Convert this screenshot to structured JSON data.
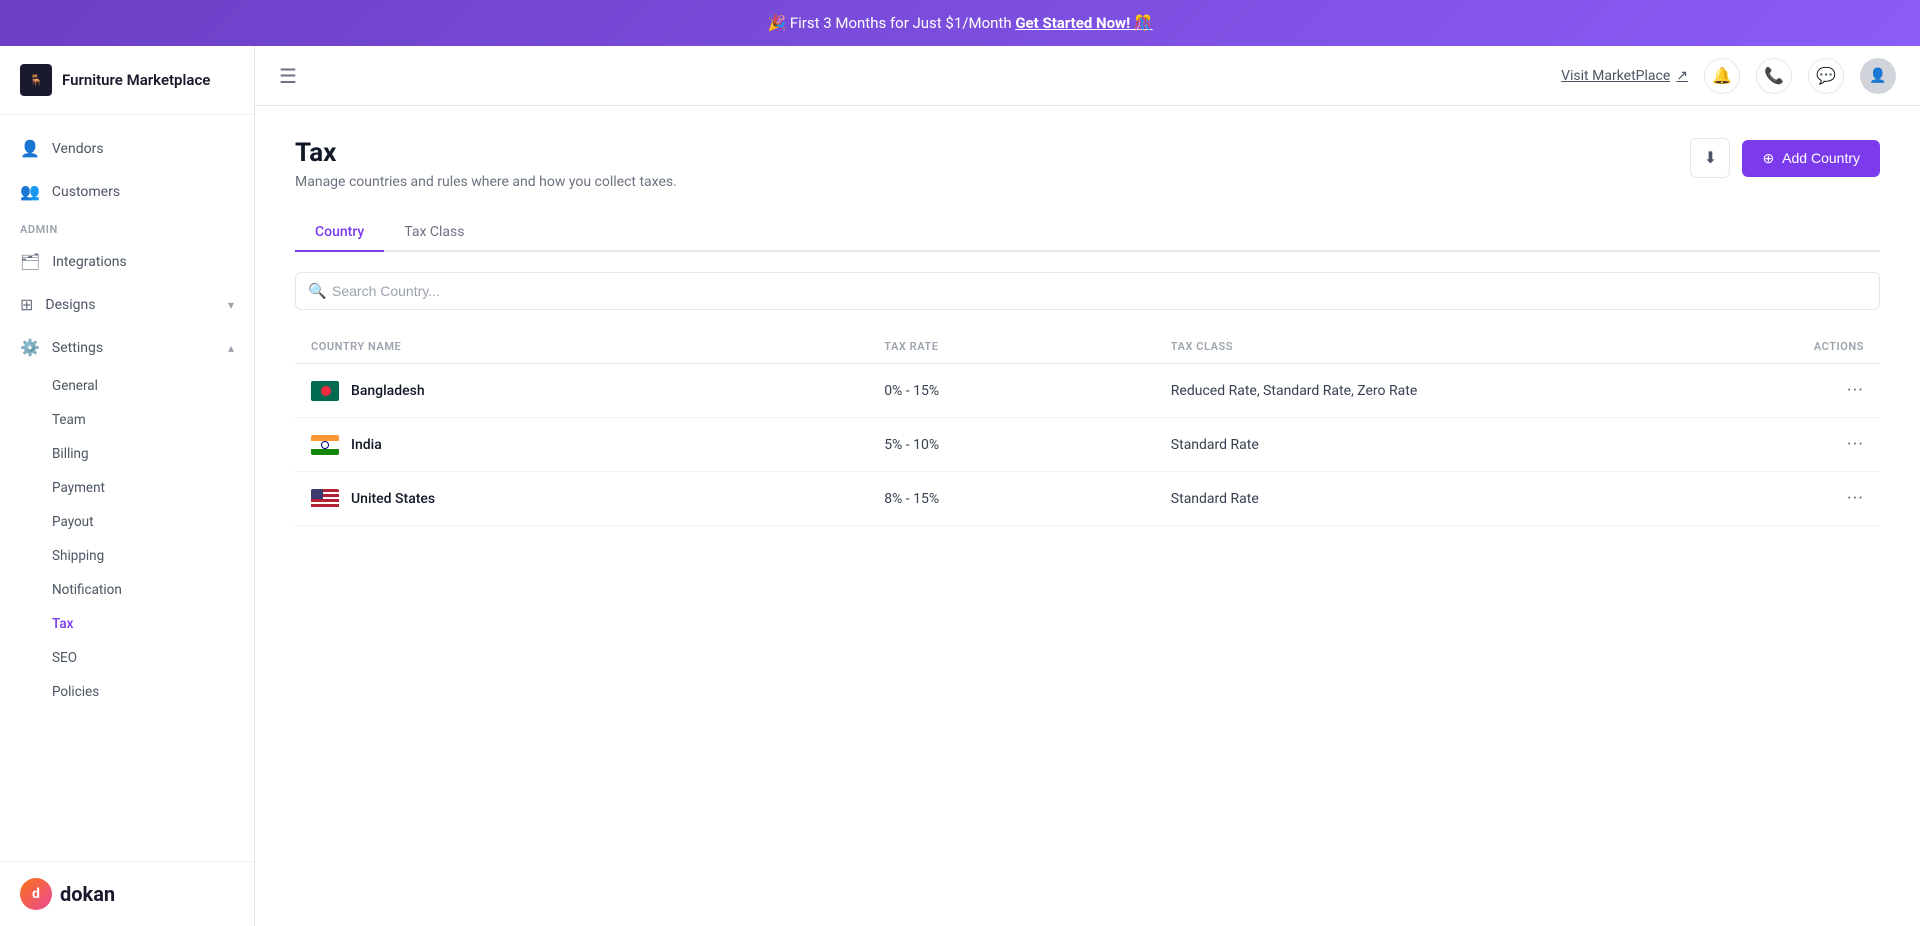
{
  "banner": {
    "text": "🎉 First 3 Months for Just $1/Month",
    "cta": "Get Started Now! 🎊"
  },
  "sidebar": {
    "brand": "Furniture Marketplace",
    "nav": [
      {
        "id": "vendors",
        "label": "Vendors",
        "icon": "👤"
      },
      {
        "id": "customers",
        "label": "Customers",
        "icon": "👥"
      }
    ],
    "admin_label": "ADMIN",
    "admin_nav": [
      {
        "id": "integrations",
        "label": "Integrations",
        "icon": "🗂"
      },
      {
        "id": "designs",
        "label": "Designs",
        "icon": "⊞",
        "has_arrow": true,
        "arrow": "▾"
      }
    ],
    "settings": {
      "label": "Settings",
      "icon": "⚙️",
      "arrow": "▴",
      "sub_items": [
        {
          "id": "general",
          "label": "General",
          "active": false
        },
        {
          "id": "team",
          "label": "Team",
          "active": false
        },
        {
          "id": "billing",
          "label": "Billing",
          "active": false
        },
        {
          "id": "payment",
          "label": "Payment",
          "active": false
        },
        {
          "id": "payout",
          "label": "Payout",
          "active": false
        },
        {
          "id": "shipping",
          "label": "Shipping",
          "active": false
        },
        {
          "id": "notification",
          "label": "Notification",
          "active": false
        },
        {
          "id": "tax",
          "label": "Tax",
          "active": true
        },
        {
          "id": "seo",
          "label": "SEO",
          "active": false
        },
        {
          "id": "policies",
          "label": "Policies",
          "active": false
        }
      ]
    },
    "footer_logo": "dokan"
  },
  "header": {
    "visit_marketplace": "Visit MarketPlace",
    "visit_icon": "↗"
  },
  "page": {
    "title": "Tax",
    "subtitle": "Manage countries and rules where and how you collect taxes.",
    "add_country_btn": "Add Country",
    "tabs": [
      {
        "id": "country",
        "label": "Country",
        "active": true
      },
      {
        "id": "tax-class",
        "label": "Tax Class",
        "active": false
      }
    ],
    "search_placeholder": "Search Country...",
    "table": {
      "headers": [
        {
          "id": "country-name",
          "label": "COUNTRY NAME"
        },
        {
          "id": "tax-rate",
          "label": "TAX RATE"
        },
        {
          "id": "tax-class",
          "label": "TAX CLASS"
        },
        {
          "id": "actions",
          "label": "ACTIONS"
        }
      ],
      "rows": [
        {
          "country": "Bangladesh",
          "flag": "bd",
          "tax_rate": "0% - 15%",
          "tax_class": "Reduced Rate, Standard Rate, Zero Rate"
        },
        {
          "country": "India",
          "flag": "in",
          "tax_rate": "5% - 10%",
          "tax_class": "Standard Rate"
        },
        {
          "country": "United States",
          "flag": "us",
          "tax_rate": "8% - 15%",
          "tax_class": "Standard Rate"
        }
      ]
    }
  }
}
